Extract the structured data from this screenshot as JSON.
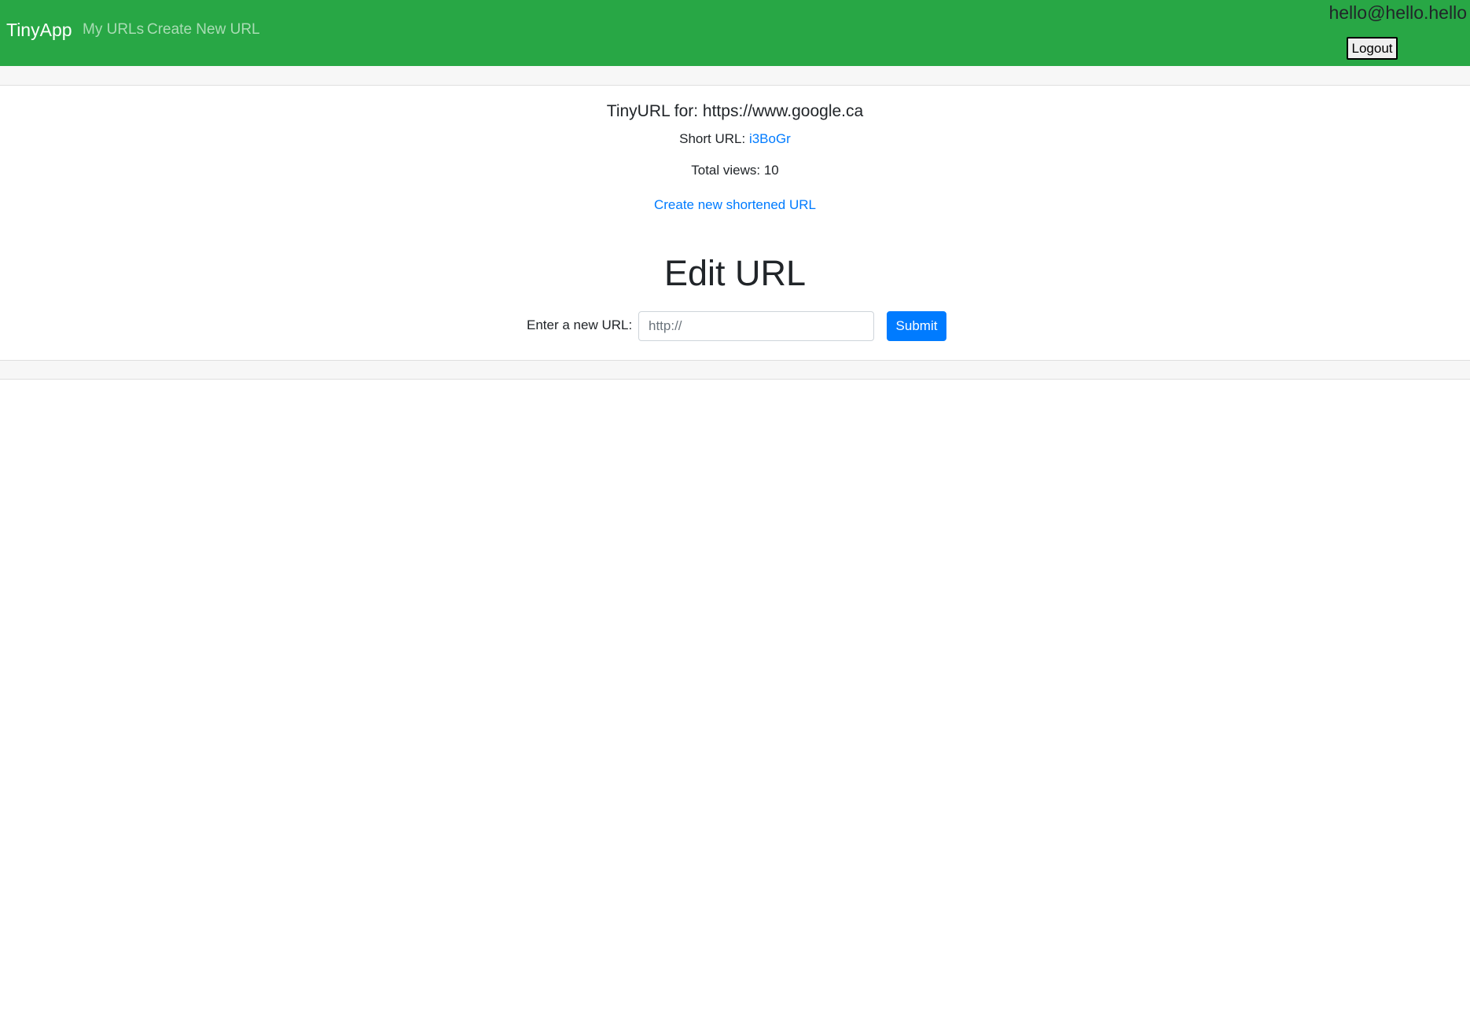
{
  "navbar": {
    "brand": "TinyApp",
    "links": [
      "My URLs",
      "Create New URL"
    ],
    "user_email": "hello@hello.hello",
    "logout_label": "Logout",
    "background_color": "#28a745"
  },
  "url_info": {
    "title_prefix": "TinyURL for: ",
    "long_url": "https://www.google.ca",
    "short_url_label": "Short URL: ",
    "short_url": "i3BoGr",
    "views_label": "Total views: ",
    "views_count": "10",
    "create_link": "Create new shortened URL"
  },
  "edit": {
    "heading": "Edit URL",
    "input_label": "Enter a new URL:",
    "input_placeholder": "http://",
    "input_value": "",
    "submit_label": "Submit"
  },
  "colors": {
    "link": "#007bff",
    "primary_button": "#007bff"
  }
}
